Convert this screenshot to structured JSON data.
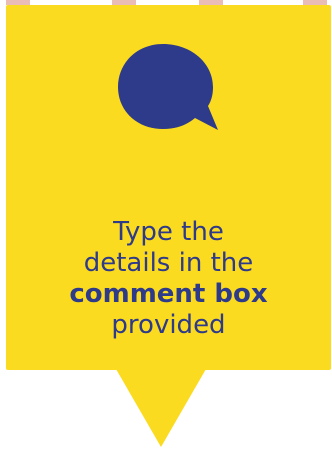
{
  "colors": {
    "callout_background": "#fadb20",
    "icon_color": "#2e3a8a",
    "text_color": "#2e3a8a",
    "top_marks": "#e9bdb6"
  },
  "icon": {
    "name": "chat-bubble-icon"
  },
  "message": {
    "line1": "Type the",
    "line2": "details in the",
    "line3_bold": "comment box",
    "line4": "provided"
  }
}
